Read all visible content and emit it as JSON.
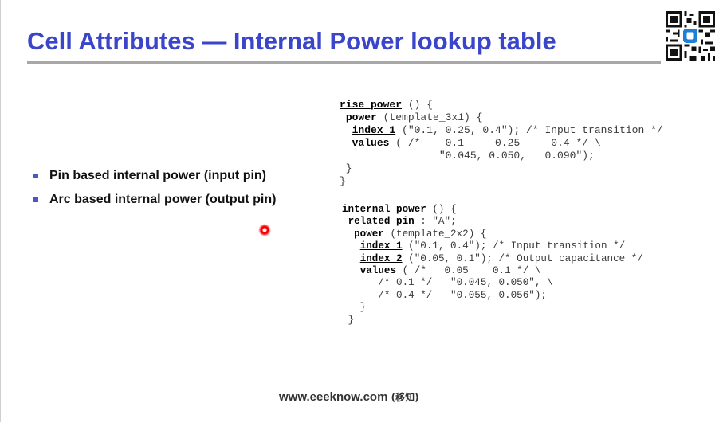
{
  "slide": {
    "title": "Cell Attributes — Internal Power lookup table",
    "bullets": [
      "Pin based internal power (input pin)",
      "Arc based internal power (output pin)"
    ],
    "footer_url": "www.eeeknow.com",
    "footer_cn": "(移知)"
  },
  "code_block_1": {
    "l1_kw": "rise_power",
    "l1_rest": " () {",
    "l2_kw": "power",
    "l2_rest": " (template_3x1) {",
    "l3_kw": "index_1",
    "l3_rest": " (\"0.1, 0.25, 0.4\"); /* Input transition */",
    "l4_kw": "values",
    "l4_rest": " ( /*    0.1     0.25     0.4 */ \\",
    "l5": "                \"0.045, 0.050,   0.090\");",
    "l6": " }",
    "l7": "}"
  },
  "code_block_2": {
    "l1_kw": "internal_power",
    "l1_rest": " () {",
    "l2_kw": "related_pin",
    "l2_rest": " : \"A\";",
    "l3_kw": "power",
    "l3_rest": " (template_2x2) {",
    "l4_kw": "index_1",
    "l4_rest": " (\"0.1, 0.4\"); /* Input transition */",
    "l5_kw": "index_2",
    "l5_rest": " (\"0.05, 0.1\"); /* Output capacitance */",
    "l6_kw": "values",
    "l6_rest": " ( /*   0.05    0.1 */ \\",
    "l7": "      /* 0.1 */   \"0.045, 0.050\", \\",
    "l8": "      /* 0.4 */   \"0.055, 0.056\");",
    "l9": "   }",
    "l10": " }"
  },
  "colors": {
    "title": "#3b45c9",
    "bullet_marker": "#4a57c8",
    "pointer": "#ff0000"
  },
  "icons": {
    "qr": "qr-code-icon",
    "bullet": "square-bullet-icon",
    "pointer": "laser-pointer-dot"
  }
}
